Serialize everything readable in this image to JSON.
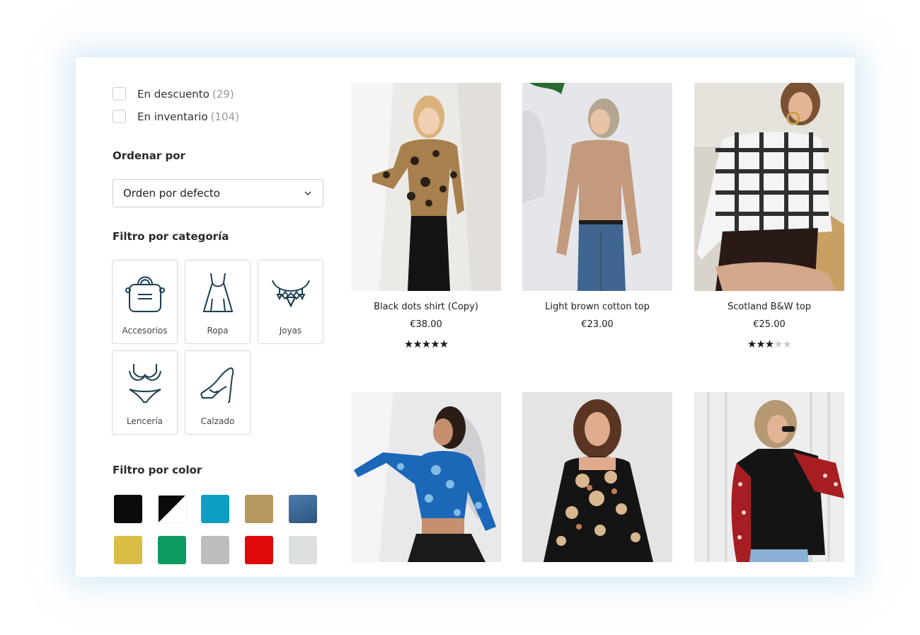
{
  "filters": {
    "checkboxes": [
      {
        "label": "En descuento",
        "count": "(29)"
      },
      {
        "label": "En inventario",
        "count": "(104)"
      }
    ]
  },
  "sort": {
    "title": "Ordenar por",
    "selected": "Orden por defecto"
  },
  "categories": {
    "title": "Filtro por categoría",
    "items": [
      {
        "label": "Accesorios",
        "icon": "handbag-icon"
      },
      {
        "label": "Ropa",
        "icon": "dress-icon"
      },
      {
        "label": "Joyas",
        "icon": "necklace-icon"
      },
      {
        "label": "Lencería",
        "icon": "lingerie-icon"
      },
      {
        "label": "Calzado",
        "icon": "high-heel-icon"
      }
    ]
  },
  "colors": {
    "title": "Filtro por color",
    "swatches": [
      "#0b0b0b",
      "black-white",
      "#0e9ec4",
      "#b5975f",
      "#3d6b99",
      "#d9bd44",
      "#0d9a63",
      "#bdbdbd",
      "#e0090b",
      "#dcdfe0"
    ]
  },
  "products": [
    {
      "name": "Black dots shirt (Copy)",
      "price": "€38.00",
      "rating": 5
    },
    {
      "name": "Light brown cotton top",
      "price": "€23.00",
      "rating": null
    },
    {
      "name": "Scotland B&W top",
      "price": "€25.00",
      "rating": 3
    },
    {
      "name": "",
      "price": "",
      "rating": null
    },
    {
      "name": "",
      "price": "",
      "rating": null
    },
    {
      "name": "",
      "price": "",
      "rating": null
    }
  ]
}
